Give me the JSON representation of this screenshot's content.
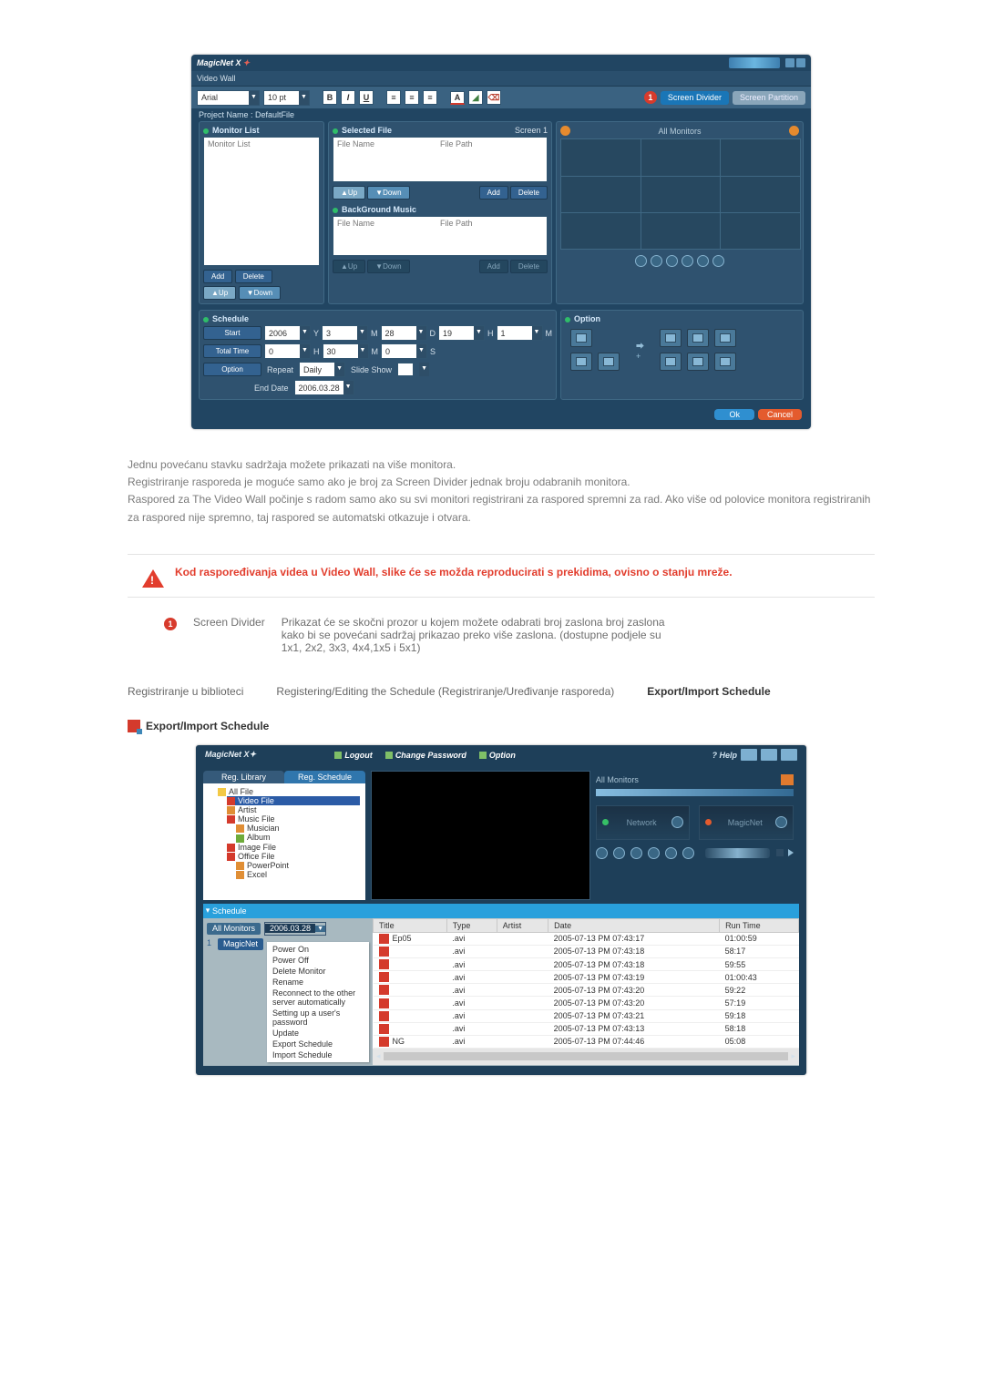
{
  "w1": {
    "title": "MagicNet X",
    "subLabel": "Video Wall",
    "font": "Arial",
    "size": "10 pt",
    "screenDivider": "Screen Divider",
    "screenPartition": "Screen Partition",
    "projectName": "Project Name : DefaultFile",
    "monitor": {
      "title": "Monitor List",
      "listLabel": "Monitor List",
      "add": "Add",
      "del": "Delete",
      "up": "▲Up",
      "down": "▼Down"
    },
    "sel": {
      "title": "Selected File",
      "screen": "Screen 1",
      "fileName": "File Name",
      "filePath": "File Path",
      "up": "▲Up",
      "down": "▼Down",
      "add": "Add",
      "del": "Delete",
      "bgTitle": "BackGround Music",
      "bgName": "File Name",
      "bgPath": "File Path"
    },
    "allMonitors": "All Monitors",
    "schedule": {
      "title": "Schedule",
      "start": "Start",
      "total": "Total Time",
      "optionLabel": "Option",
      "d": {
        "year": "2006",
        "y": "Y",
        "m1": "3",
        "mlbl": "M",
        "day": "28",
        "dlbl": "D",
        "hh": "19",
        "hlbl": "H",
        "mm": "1",
        "mmlbl": "M"
      },
      "tt": {
        "h": "0",
        "hl": "H",
        "m": "30",
        "ml": "M",
        "s": "0",
        "sl": "S"
      },
      "repeat": "Repeat",
      "daily": "Daily",
      "slideshow": "Slide Show",
      "endDate": "End Date",
      "end": "2006.03.28"
    },
    "option": "Option",
    "ok": "Ok",
    "cancel": "Cancel"
  },
  "text": {
    "p1": "Jednu povećanu stavku sadržaja možete prikazati na više monitora.",
    "p2": "Registriranje rasporeda je moguće samo ako je broj za Screen Divider jednak broju odabranih monitora.",
    "p3": "Raspored za The Video Wall počinje s radom samo ako su svi monitori registrirani za raspored spremni za rad. Ako više od polovice monitora registriranih za raspored nije spremno, taj raspored se automatski otkazuje i otvara.",
    "warn": "Kod raspoređivanja videa u Video Wall, slike će se možda reproducirati s prekidima, ovisno o stanju mreže.",
    "itemLabel": "Screen Divider",
    "itemDesc": "Prikazat će se skočni prozor u kojem možete odabrati broj zaslona broj zaslona kako bi se povećani sadržaj prikazao preko više zaslona. (dostupne podjele su 1x1, 2x2, 3x3, 4x4,1x5 i 5x1)"
  },
  "tabs": {
    "a": "Registriranje u biblioteci",
    "b": "Registering/Editing the Schedule (Registriranje/Uređivanje rasporeda)",
    "c": "Export/Import Schedule"
  },
  "hdr": "Export/Import Schedule",
  "w2": {
    "title": "MagicNet X",
    "logout": "Logout",
    "changePw": "Change Password",
    "option": "Option",
    "help": "Help",
    "tabLib": "Reg. Library",
    "tabSched": "Reg. Schedule",
    "tree": {
      "all": "All File",
      "video": "Video File",
      "artist": "Artist",
      "music": "Music File",
      "musician": "Musician",
      "album": "Album",
      "image": "Image File",
      "office": "Office File",
      "ppt": "PowerPoint",
      "excel": "Excel"
    },
    "allMonitors": "All Monitors",
    "network": "Network",
    "magicnet": "MagicNet",
    "schedule": "Schedule",
    "allmon2": "All Monitors",
    "date": "2006.03.28",
    "leftblue": "MagicNet",
    "ctx": [
      "Power On",
      "Power Off",
      "Delete Monitor",
      "Rename",
      "Reconnect to the other server automatically",
      "Setting up a user's password",
      "Update",
      "Export Schedule",
      "Import Schedule"
    ],
    "cols": {
      "title": "Title",
      "type": "Type",
      "artist": "Artist",
      "date": "Date",
      "run": "Run Time"
    },
    "rows": [
      {
        "title": "Ep05",
        "type": ".avi",
        "artist": "",
        "date": "2005-07-13 PM 07:43:17",
        "run": "01:00:59"
      },
      {
        "title": "",
        "type": ".avi",
        "artist": "",
        "date": "2005-07-13 PM 07:43:18",
        "run": "58:17"
      },
      {
        "title": "",
        "type": ".avi",
        "artist": "",
        "date": "2005-07-13 PM 07:43:18",
        "run": "59:55"
      },
      {
        "title": "",
        "type": ".avi",
        "artist": "",
        "date": "2005-07-13 PM 07:43:19",
        "run": "01:00:43"
      },
      {
        "title": "",
        "type": ".avi",
        "artist": "",
        "date": "2005-07-13 PM 07:43:20",
        "run": "59:22"
      },
      {
        "title": "",
        "type": ".avi",
        "artist": "",
        "date": "2005-07-13 PM 07:43:20",
        "run": "57:19"
      },
      {
        "title": "",
        "type": ".avi",
        "artist": "",
        "date": "2005-07-13 PM 07:43:21",
        "run": "59:18"
      },
      {
        "title": "",
        "type": ".avi",
        "artist": "",
        "date": "2005-07-13 PM 07:43:13",
        "run": "58:18"
      },
      {
        "title": "NG",
        "type": ".avi",
        "artist": "",
        "date": "2005-07-13 PM 07:44:46",
        "run": "05:08"
      }
    ],
    "rowNum": "1"
  }
}
